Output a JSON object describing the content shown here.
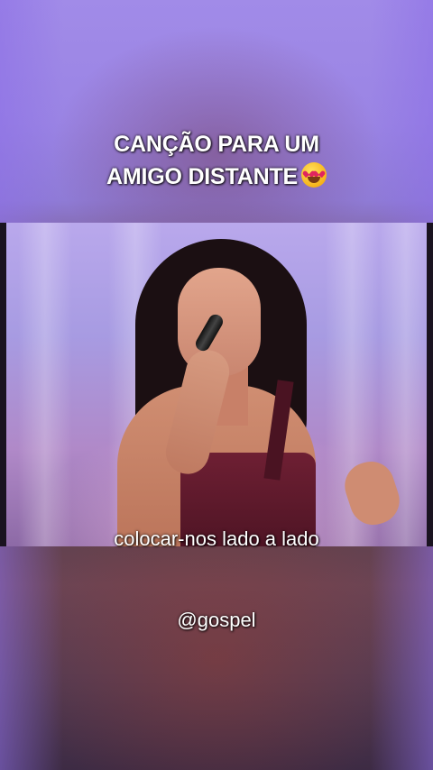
{
  "title": {
    "line1": "CANÇÃO PARA UM",
    "line2": "AMIGO DISTANTE",
    "emoji": "smiling-face-with-heart-eyes"
  },
  "video": {
    "subtitle": "colocar-nos lado a lado"
  },
  "author_handle": "@gospel"
}
